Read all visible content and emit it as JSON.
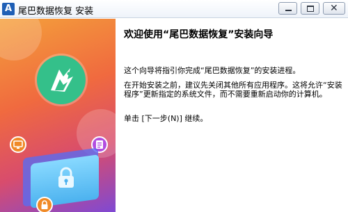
{
  "window": {
    "title": "尾巴数据恢复 安装",
    "app_icon_letter": "A"
  },
  "controls": {
    "minimize": "minimize-icon",
    "maximize": "maximize-icon",
    "close": "close-icon",
    "close_glyph": "✕"
  },
  "banner": {
    "colors": {
      "top": "#f4a03b",
      "mid": "#f06a3f",
      "bottom": "#7f49d3",
      "logo": "#34c08a"
    },
    "icons": [
      "app-logo-icon",
      "monitor-icon",
      "document-icon",
      "padlock-icon",
      "device-lock-icon"
    ]
  },
  "content": {
    "heading": "欢迎使用“尾巴数据恢复”安装向导",
    "paragraphs": [
      "这个向导将指引你完成“尾巴数据恢复”的安装进程。",
      "在开始安装之前，建议先关闭其他所有应用程序。这将允许“安装程序”更新指定的系统文件，而不需要重新启动你的计算机。",
      "单击 [下一步(N)] 继续。"
    ]
  }
}
